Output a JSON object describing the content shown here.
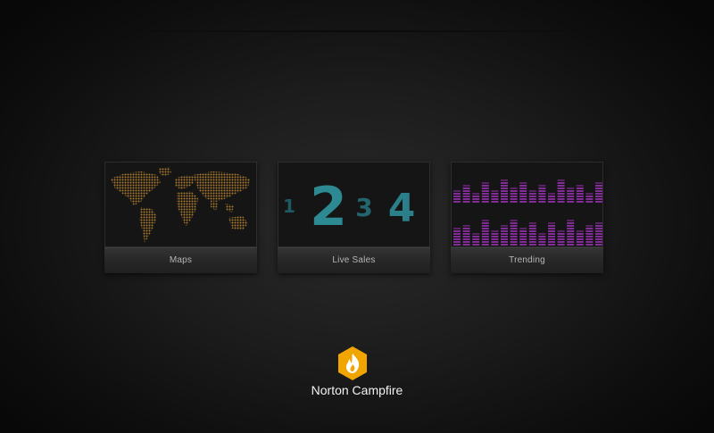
{
  "tiles": [
    {
      "label": "Maps",
      "icon": "world-map-icon",
      "accent": "#b8872f"
    },
    {
      "label": "Live Sales",
      "icon": "digits-icon",
      "accent": "#2f8d96",
      "digits": [
        "1",
        "2",
        "3",
        "4"
      ]
    },
    {
      "label": "Trending",
      "icon": "equalizer-icon",
      "accent": "#8e2fa6"
    }
  ],
  "brand": {
    "name": "Norton Campfire",
    "icon": "campfire-flame-icon",
    "color": "#f0a500"
  }
}
